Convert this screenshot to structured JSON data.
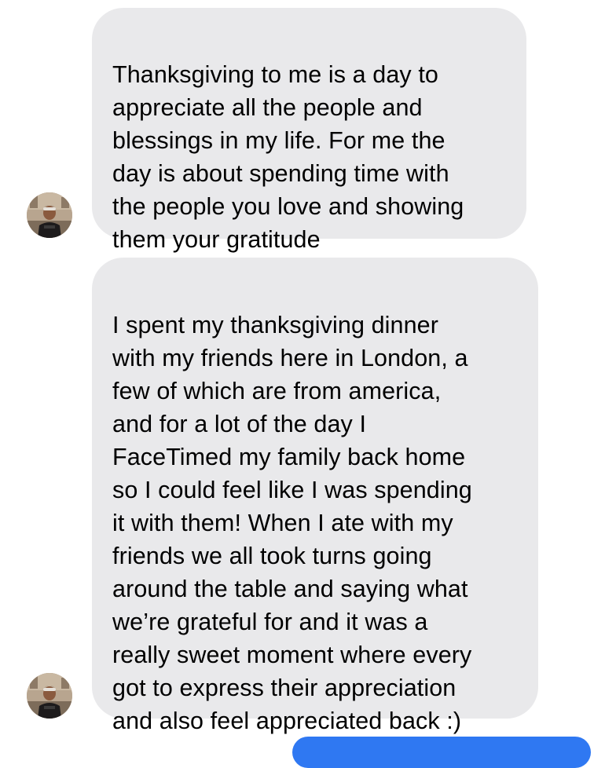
{
  "conversation": {
    "messages": [
      {
        "sender": "incoming",
        "text": "Thanksgiving to me is a day to\nappreciate all the people and\nblessings in my life. For me the\nday is about spending time with\nthe people you love and showing\nthem your gratitude"
      },
      {
        "sender": "incoming",
        "text": "I spent my thanksgiving dinner\nwith my friends here in London, a\nfew of which are from america,\nand for a lot of the day I\nFaceTimed my family back home\nso I could feel like I was spending\nit with them! When I ate with my\nfriends we all took turns going\naround the table and saying what\nwe’re grateful for and it was a\nreally sweet moment where every\ngot to express their appreciation\nand also feel appreciated back :)"
      }
    ],
    "colors": {
      "incoming_bubble": "#e9e9eb",
      "outgoing_bubble": "#2f78f2",
      "text": "#000000",
      "background": "#ffffff"
    }
  }
}
